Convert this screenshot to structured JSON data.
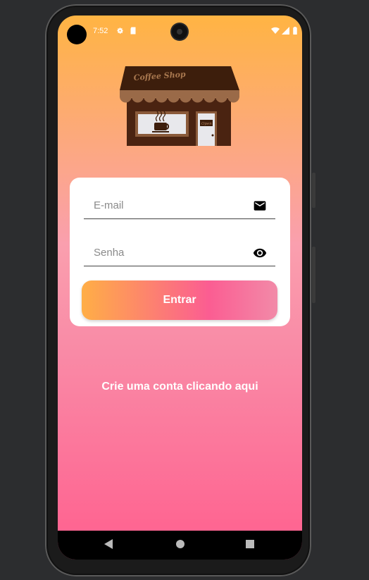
{
  "status_bar": {
    "time": "7:52",
    "left_icons": [
      "gear-icon",
      "sd-card-icon"
    ],
    "right_icons": [
      "wifi-icon",
      "signal-icon",
      "battery-icon"
    ]
  },
  "logo": {
    "sign_text": "Coffee Shop",
    "door_sign": "Open"
  },
  "login_form": {
    "email_placeholder": "E-mail",
    "email_icon": "mail-icon",
    "password_placeholder": "Senha",
    "password_icon": "eye-icon",
    "submit_label": "Entrar"
  },
  "signup_link": "Crie uma conta clicando aqui",
  "nav_bar": {
    "buttons": [
      "back-icon",
      "home-icon",
      "recents-icon"
    ]
  },
  "colors": {
    "gradient_top": "#ffb443",
    "gradient_bottom": "#ff5f8e",
    "card": "#ffffff",
    "button_start": "#ffae46",
    "button_end": "#fb5d92"
  }
}
